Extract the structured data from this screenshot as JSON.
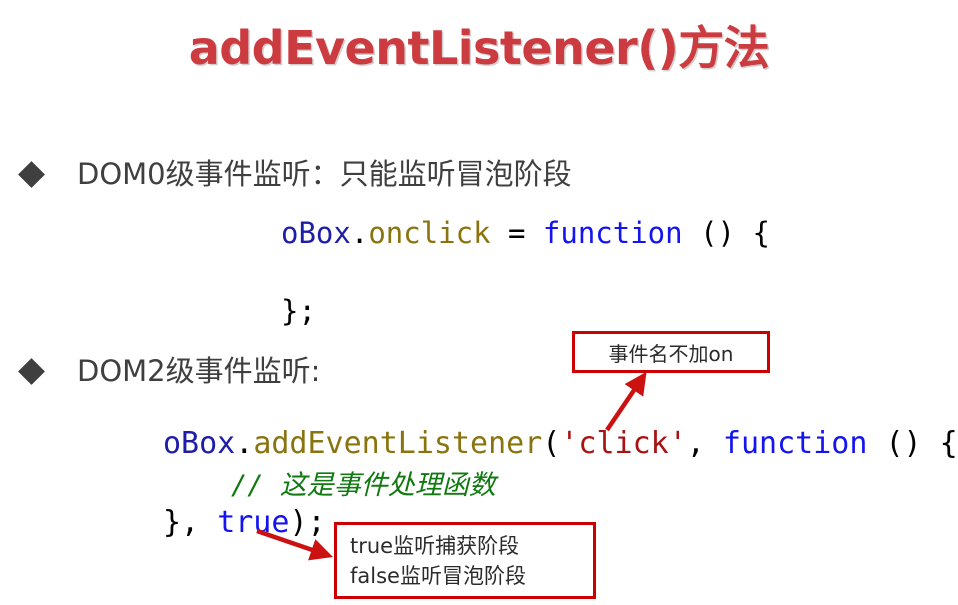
{
  "slide": {
    "title": "addEventListener()方法",
    "title_color": "#cc3b40",
    "background": "#ffffff"
  },
  "bullets": [
    {
      "marker": "diamond-bullet",
      "text": "DOM0级事件监听：只能监听冒泡阶段"
    },
    {
      "marker": "diamond-bullet",
      "text": "DOM2级事件监听:"
    }
  ],
  "code_blocks": [
    {
      "id": "dom0-handler",
      "lines": [
        {
          "tokens": [
            {
              "text": "oBox",
              "kind": "object",
              "color": "#1d1da8"
            },
            {
              "text": ".",
              "kind": "punctuation",
              "color": "#000000"
            },
            {
              "text": "onclick",
              "kind": "property",
              "color": "#8a7410"
            },
            {
              "text": " = ",
              "kind": "operator",
              "color": "#000000"
            },
            {
              "text": "function",
              "kind": "keyword",
              "color": "#1414f0"
            },
            {
              "text": " () {",
              "kind": "punctuation",
              "color": "#000000"
            }
          ]
        },
        {
          "tokens": [
            {
              "text": "};",
              "kind": "punctuation",
              "color": "#000000"
            }
          ]
        }
      ]
    },
    {
      "id": "dom2-handler",
      "lines": [
        {
          "tokens": [
            {
              "text": "oBox",
              "kind": "object",
              "color": "#1d1da8"
            },
            {
              "text": ".",
              "kind": "punctuation",
              "color": "#000000"
            },
            {
              "text": "addEventListener",
              "kind": "property",
              "color": "#8a7410"
            },
            {
              "text": "(",
              "kind": "punctuation",
              "color": "#000000"
            },
            {
              "text": "'click'",
              "kind": "string",
              "color": "#a81414"
            },
            {
              "text": ", ",
              "kind": "punctuation",
              "color": "#000000"
            },
            {
              "text": "function",
              "kind": "keyword",
              "color": "#1414f0"
            },
            {
              "text": " () {",
              "kind": "punctuation",
              "color": "#000000"
            }
          ]
        },
        {
          "tokens": [
            {
              "text": "// 这是事件处理函数",
              "kind": "comment",
              "color": "#107a10"
            }
          ]
        },
        {
          "tokens": [
            {
              "text": "}, ",
              "kind": "punctuation",
              "color": "#000000"
            },
            {
              "text": "true",
              "kind": "keyword",
              "color": "#1414f0"
            },
            {
              "text": ");",
              "kind": "punctuation",
              "color": "#000000"
            }
          ]
        }
      ]
    }
  ],
  "code_text": {
    "dom0_line1_obj": "oBox",
    "dom0_line1_dot": ".",
    "dom0_line1_prop": "onclick",
    "dom0_line1_eq": " = ",
    "dom0_line1_kw": "function",
    "dom0_line1_tail": " () {",
    "dom0_line2": "};",
    "dom2_line1_obj": "oBox",
    "dom2_line1_dot": ".",
    "dom2_line1_prop": "addEventListener",
    "dom2_line1_open": "(",
    "dom2_line1_str": "'click'",
    "dom2_line1_comma": ", ",
    "dom2_line1_kw": "function",
    "dom2_line1_tail": " () {",
    "dom2_comment": "// 这是事件处理函数",
    "dom2_line3_close": "}, ",
    "dom2_line3_bool": "true",
    "dom2_line3_tail": ");"
  },
  "callouts": [
    {
      "id": "event-name-note",
      "border_color": "#cc0000",
      "lines": [
        "事件名不加on"
      ],
      "points_to": "'click' argument"
    },
    {
      "id": "capture-phase-note",
      "border_color": "#cc0000",
      "lines": [
        "true监听捕获阶段",
        "false监听冒泡阶段"
      ],
      "points_to": "true argument"
    }
  ],
  "arrows": [
    {
      "id": "arrow-to-click",
      "color": "#cc1111",
      "direction": "up-right"
    },
    {
      "id": "arrow-to-true",
      "color": "#cc1111",
      "direction": "down-right"
    }
  ]
}
